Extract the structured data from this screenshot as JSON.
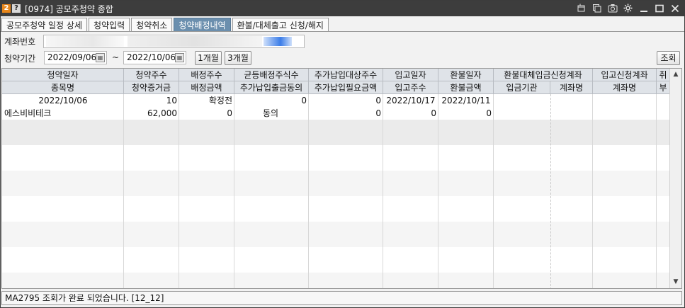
{
  "titlebar": {
    "number_badge": "2",
    "help_badge": "?",
    "title": "[0974] 공모주청약 종합",
    "icons": [
      "window-icon",
      "copy-icon",
      "camera-icon",
      "settings-icon",
      "minimize-icon",
      "maximize-icon",
      "close-icon"
    ]
  },
  "tabs": [
    {
      "label": "공모주청약 일정 상세",
      "active": false
    },
    {
      "label": "청약입력",
      "active": false
    },
    {
      "label": "청약취소",
      "active": false
    },
    {
      "label": "청약배정내역",
      "active": true
    },
    {
      "label": "환불/대체출고 신청/해지",
      "active": false
    }
  ],
  "form": {
    "account_label": "계좌번호",
    "period_label": "청약기간",
    "from_date": "2022/09/06",
    "to_date": "2022/10/06",
    "tilde": "~",
    "one_month": "1개월",
    "three_month": "3개월",
    "search": "조회"
  },
  "grid": {
    "headers_row1": [
      "청약일자",
      "청약주수",
      "배정주수",
      "균등배정주식수",
      "추가납입대상주수",
      "입고일자",
      "환불일자",
      "환불대체입금신청계좌",
      "입고신청계좌",
      "취"
    ],
    "headers_row2": [
      "종목명",
      "청약증거금",
      "배정금액",
      "추가납입출금동의",
      "추가납입필요금액",
      "입고주수",
      "환불금액",
      "입금기관",
      "계좌명",
      "계좌명",
      "부"
    ],
    "rows": [
      {
        "line1": [
          "2022/10/06",
          "10",
          "확정전",
          "0",
          "0",
          "2022/10/17",
          "2022/10/11",
          "",
          "",
          ""
        ],
        "line2": [
          "에스비비테크",
          "62,000",
          "0",
          "동의",
          "0",
          "0",
          "0",
          "",
          "",
          ""
        ]
      }
    ]
  },
  "status": {
    "message": "MA2795 조회가 완료 되었습니다. [12_12]"
  },
  "colors": {
    "titlebar": "#3d3d3d",
    "active_tab": "#6b8fae",
    "header_bg": "#dfe3e8",
    "stripe": "#ebebeb"
  }
}
